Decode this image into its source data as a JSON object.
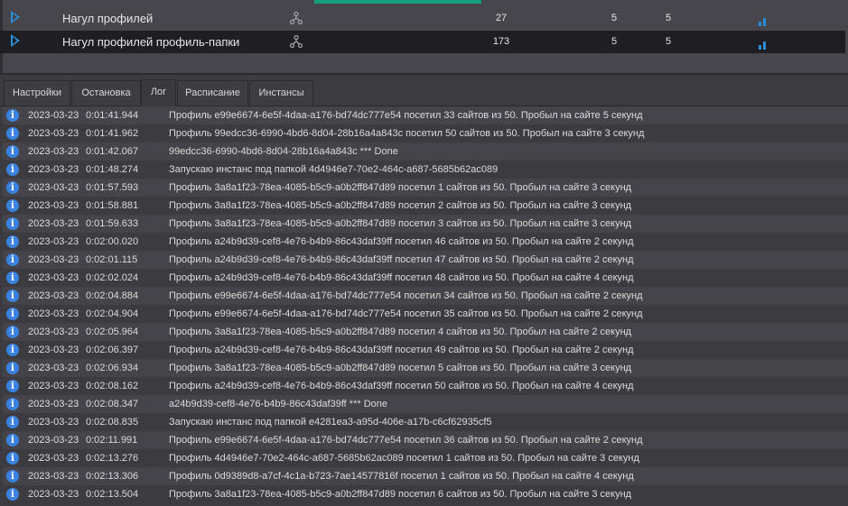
{
  "tasks": [
    {
      "name": "Нагул профилей",
      "count": "27",
      "col_a": "5",
      "col_b": "5"
    },
    {
      "name": "Нагул профилей профиль-папки",
      "count": "173",
      "col_a": "5",
      "col_b": "5"
    }
  ],
  "tabs": [
    "Настройки",
    "Остановка",
    "Лог",
    "Расписание",
    "Инстансы"
  ],
  "active_tab": "Лог",
  "log": [
    [
      "2023-03-23",
      "0:01:41.944",
      "Профиль e99e6674-6e5f-4daa-a176-bd74dc777e54 посетил 33 сайтов из 50. Пробыл на сайте 5 секунд"
    ],
    [
      "2023-03-23",
      "0:01:41.962",
      "Профиль 99edcc36-6990-4bd6-8d04-28b16a4a843c посетил 50 сайтов из 50. Пробыл на сайте 3 секунд"
    ],
    [
      "2023-03-23",
      "0:01:42.067",
      "99edcc36-6990-4bd6-8d04-28b16a4a843c *** Done"
    ],
    [
      "2023-03-23",
      "0:01:48.274",
      "Запускаю инстанс под папкой 4d4946e7-70e2-464c-a687-5685b62ac089"
    ],
    [
      "2023-03-23",
      "0:01:57.593",
      "Профиль 3a8a1f23-78ea-4085-b5c9-a0b2ff847d89 посетил 1 сайтов из 50. Пробыл на сайте 3 секунд"
    ],
    [
      "2023-03-23",
      "0:01:58.881",
      "Профиль 3a8a1f23-78ea-4085-b5c9-a0b2ff847d89 посетил 2 сайтов из 50. Пробыл на сайте 3 секунд"
    ],
    [
      "2023-03-23",
      "0:01:59.633",
      "Профиль 3a8a1f23-78ea-4085-b5c9-a0b2ff847d89 посетил 3 сайтов из 50. Пробыл на сайте 3 секунд"
    ],
    [
      "2023-03-23",
      "0:02:00.020",
      "Профиль a24b9d39-cef8-4e76-b4b9-86c43daf39ff посетил 46 сайтов из 50. Пробыл на сайте 2 секунд"
    ],
    [
      "2023-03-23",
      "0:02:01.115",
      "Профиль a24b9d39-cef8-4e76-b4b9-86c43daf39ff посетил 47 сайтов из 50. Пробыл на сайте 2 секунд"
    ],
    [
      "2023-03-23",
      "0:02:02.024",
      "Профиль a24b9d39-cef8-4e76-b4b9-86c43daf39ff посетил 48 сайтов из 50. Пробыл на сайте 4 секунд"
    ],
    [
      "2023-03-23",
      "0:02:04.884",
      "Профиль e99e6674-6e5f-4daa-a176-bd74dc777e54 посетил 34 сайтов из 50. Пробыл на сайте 2 секунд"
    ],
    [
      "2023-03-23",
      "0:02:04.904",
      "Профиль e99e6674-6e5f-4daa-a176-bd74dc777e54 посетил 35 сайтов из 50. Пробыл на сайте 2 секунд"
    ],
    [
      "2023-03-23",
      "0:02:05.964",
      "Профиль 3a8a1f23-78ea-4085-b5c9-a0b2ff847d89 посетил 4 сайтов из 50. Пробыл на сайте 2 секунд"
    ],
    [
      "2023-03-23",
      "0:02:06.397",
      "Профиль a24b9d39-cef8-4e76-b4b9-86c43daf39ff посетил 49 сайтов из 50. Пробыл на сайте 2 секунд"
    ],
    [
      "2023-03-23",
      "0:02:06.934",
      "Профиль 3a8a1f23-78ea-4085-b5c9-a0b2ff847d89 посетил 5 сайтов из 50. Пробыл на сайте 3 секунд"
    ],
    [
      "2023-03-23",
      "0:02:08.162",
      "Профиль a24b9d39-cef8-4e76-b4b9-86c43daf39ff посетил 50 сайтов из 50. Пробыл на сайте 4 секунд"
    ],
    [
      "2023-03-23",
      "0:02:08.347",
      "a24b9d39-cef8-4e76-b4b9-86c43daf39ff *** Done"
    ],
    [
      "2023-03-23",
      "0:02:08.835",
      "Запускаю инстанс под папкой e4281ea3-a95d-406e-a17b-c6cf62935cf5"
    ],
    [
      "2023-03-23",
      "0:02:11.991",
      "Профиль e99e6674-6e5f-4daa-a176-bd74dc777e54 посетил 36 сайтов из 50. Пробыл на сайте 2 секунд"
    ],
    [
      "2023-03-23",
      "0:02:13.276",
      "Профиль 4d4946e7-70e2-464c-a687-5685b62ac089 посетил 1 сайтов из 50. Пробыл на сайте 3 секунд"
    ],
    [
      "2023-03-23",
      "0:02:13.306",
      "Профиль 0d9389d8-a7cf-4c1a-b723-7ae14577816f посетил 1 сайтов из 50. Пробыл на сайте 4 секунд"
    ],
    [
      "2023-03-23",
      "0:02:13.504",
      "Профиль 3a8a1f23-78ea-4085-b5c9-a0b2ff847d89 посетил 6 сайтов из 50. Пробыл на сайте 3 секунд"
    ]
  ],
  "icons": {
    "play": "play-icon",
    "fork": "fork-icon",
    "stats": "bar-chart-icon",
    "info": "info-icon"
  },
  "colors": {
    "accent": "#2a8fd8",
    "progress": "#13a07a",
    "info": "#3b82e0"
  }
}
